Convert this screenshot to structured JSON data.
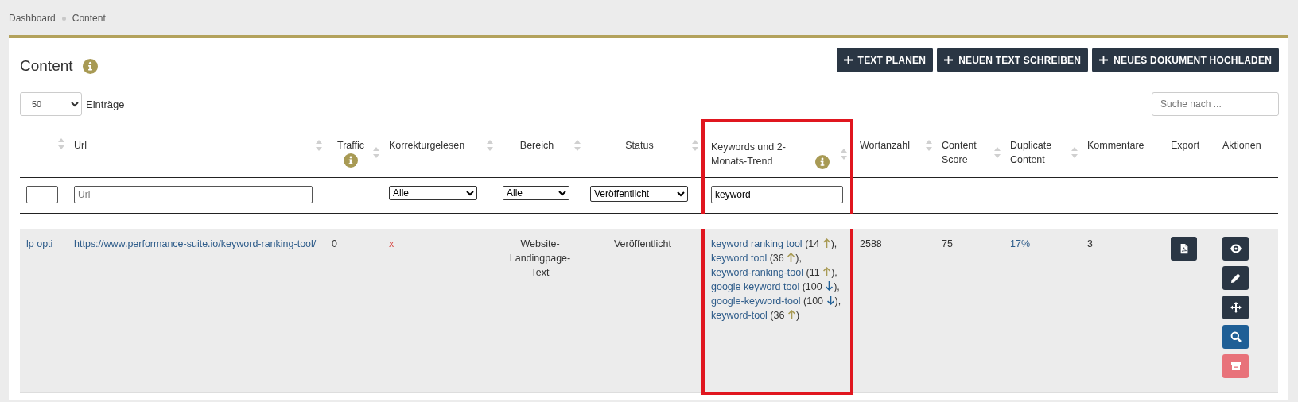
{
  "breadcrumb": [
    "Dashboard",
    "Content"
  ],
  "title": "Content",
  "buttons": [
    {
      "label": "TEXT PLANEN"
    },
    {
      "label": "NEUEN TEXT SCHREIBEN"
    },
    {
      "label": "NEUES DOKUMENT HOCHLADEN"
    }
  ],
  "page_size": {
    "value": "50",
    "label": "Einträge"
  },
  "search": {
    "placeholder": "Suche nach ..."
  },
  "table": {
    "columns": [
      {
        "sortable": true,
        "info": false,
        "highlighted": false,
        "filter": {
          "kind": "input"
        }
      },
      {
        "label": "Url",
        "sortable": true,
        "info": false,
        "highlighted": false,
        "filter": {
          "kind": "input",
          "placeholder": "Url"
        }
      },
      {
        "label": "Traffic",
        "sortable": true,
        "info": true,
        "highlighted": false
      },
      {
        "label": "Korrekturgelesen",
        "sortable": true,
        "info": false,
        "highlighted": false,
        "filter": {
          "kind": "select",
          "value": "Alle"
        }
      },
      {
        "label": "Bereich",
        "sortable": true,
        "info": false,
        "highlighted": false,
        "filter": {
          "kind": "select",
          "value": "Alle"
        }
      },
      {
        "label": "Status",
        "sortable": true,
        "info": false,
        "highlighted": false,
        "filter": {
          "kind": "select",
          "value": "Veröffentlicht"
        }
      },
      {
        "label": "Keywords und 2-Monats-Trend",
        "sortable": true,
        "info": true,
        "highlighted": true,
        "filter": {
          "kind": "input",
          "value": "keyword"
        }
      },
      {
        "label": "Wortanzahl",
        "sortable": true,
        "info": false,
        "highlighted": false
      },
      {
        "label": "Content Score",
        "sortable": true,
        "info": false,
        "highlighted": false
      },
      {
        "label": "Duplicate Content",
        "sortable": true,
        "info": false,
        "highlighted": false
      },
      {
        "label": "Kommentare",
        "sortable": false,
        "info": false,
        "highlighted": false
      },
      {
        "label": "Export",
        "sortable": false,
        "info": false,
        "highlighted": false
      },
      {
        "label": "Aktionen",
        "sortable": false,
        "info": false,
        "highlighted": false
      }
    ],
    "rows": [
      {
        "cells": [
          {
            "kind": "link",
            "text": "lp opti"
          },
          {
            "kind": "link",
            "text": "https://www.performance-suite.io/keyword-ranking-tool/"
          },
          {
            "kind": "text",
            "text": "0"
          },
          {
            "kind": "cross",
            "text": "x"
          },
          {
            "kind": "center",
            "text": "Website-Landingpage-Text"
          },
          {
            "kind": "center",
            "text": "Veröffentlicht"
          },
          {
            "kind": "keywords",
            "items": [
              {
                "keyword": "keyword ranking tool",
                "count": "(14",
                "rising": true,
                "suffix": "),"
              },
              {
                "keyword": "keyword tool",
                "count": "(36",
                "rising": true,
                "suffix": "),"
              },
              {
                "keyword": "keyword-ranking-tool",
                "count": "(11",
                "rising": true,
                "suffix": "),"
              },
              {
                "keyword": "google keyword tool",
                "count": "(100",
                "rising": false,
                "suffix": "),"
              },
              {
                "keyword": "google-keyword-tool",
                "count": "(100",
                "rising": false,
                "suffix": "),"
              },
              {
                "keyword": "keyword-tool",
                "count": "(36",
                "rising": true,
                "suffix": ")"
              }
            ]
          },
          {
            "kind": "text",
            "text": "2588"
          },
          {
            "kind": "text",
            "text": "75"
          },
          {
            "kind": "link",
            "text": "17%"
          },
          {
            "kind": "text",
            "text": "3"
          },
          {
            "kind": "export"
          },
          {
            "kind": "actions",
            "actions": [
              {
                "kind": "view"
              },
              {
                "kind": "edit"
              },
              {
                "kind": "move"
              },
              {
                "kind": "search"
              },
              {
                "kind": "archive"
              }
            ]
          }
        ]
      }
    ]
  }
}
